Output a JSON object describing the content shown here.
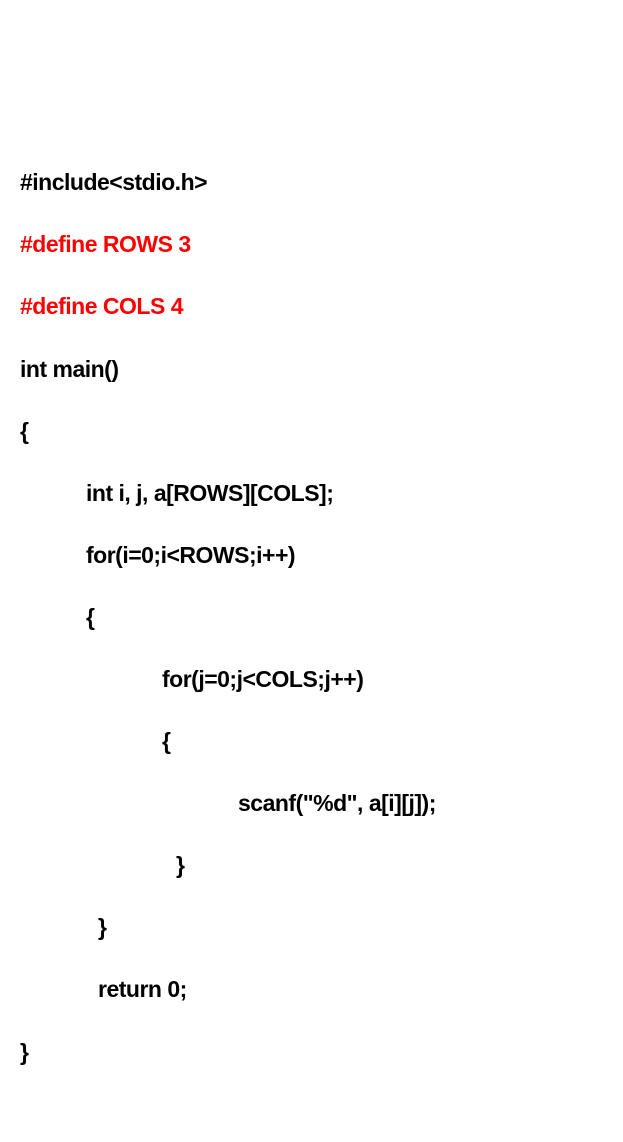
{
  "code": {
    "l1": "#include<stdio.h>",
    "l2": "#define ROWS 3",
    "l3": "#define COLS 4",
    "l4": "int main()",
    "l5": "{",
    "l6": "int i, j, a[ROWS][COLS];",
    "l7": "for(i=0;i<ROWS;i++)",
    "l8": "{",
    "l9": "for(j=0;j<COLS;j++)",
    "l10": "{",
    "l11": "scanf(\"%d\", a[i][j]);",
    "l12": "}",
    "l13": "}",
    "l14": "return 0;",
    "l15": "}"
  }
}
